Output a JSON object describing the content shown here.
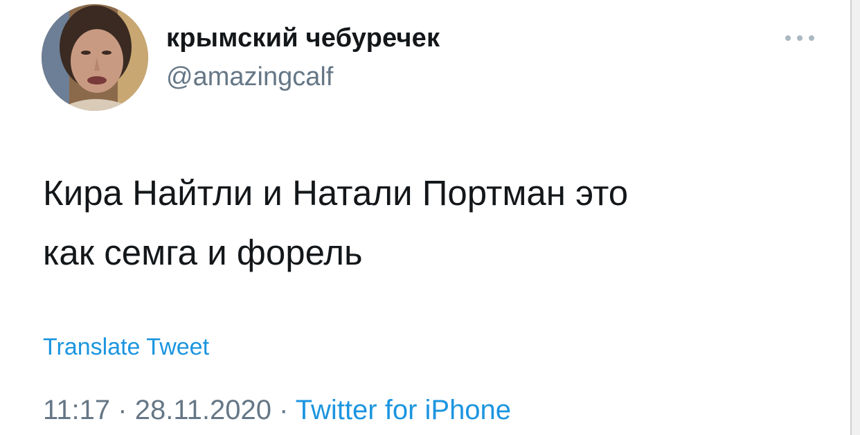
{
  "tweet": {
    "author": {
      "display_name": "крымский чебуречек",
      "handle": "@amazingcalf"
    },
    "text_lines": [
      "Кира Найтли и Натали Портман это",
      "как семга и форель"
    ],
    "translate_label": "Translate Tweet",
    "time": "11:17",
    "separator": "·",
    "date": "28.11.2020",
    "source": "Twitter for iPhone"
  },
  "icons": {
    "more": "more-horizontal-icon",
    "avatar": "avatar-photo"
  },
  "colors": {
    "text": "#14171a",
    "secondary": "#657786",
    "link": "#1b95e0",
    "background": "#ffffff"
  }
}
